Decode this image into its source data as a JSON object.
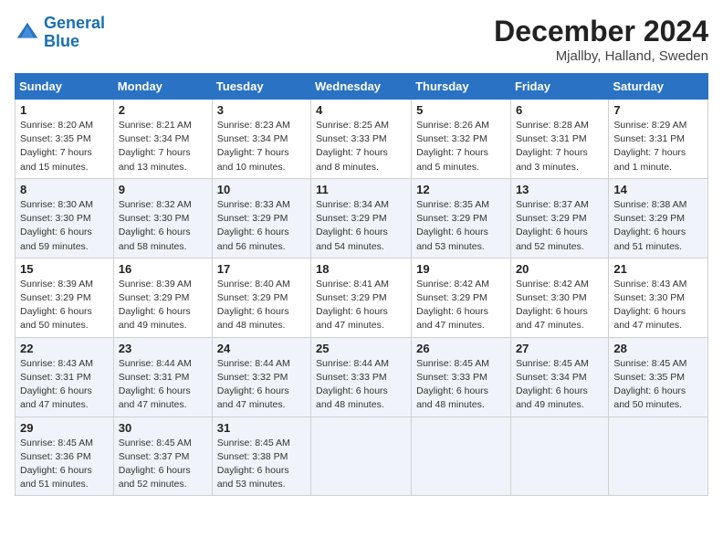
{
  "logo": {
    "line1": "General",
    "line2": "Blue"
  },
  "title": "December 2024",
  "location": "Mjallby, Halland, Sweden",
  "weekdays": [
    "Sunday",
    "Monday",
    "Tuesday",
    "Wednesday",
    "Thursday",
    "Friday",
    "Saturday"
  ],
  "weeks": [
    [
      {
        "day": "1",
        "sunrise": "8:20 AM",
        "sunset": "3:35 PM",
        "daylight": "7 hours and 15 minutes."
      },
      {
        "day": "2",
        "sunrise": "8:21 AM",
        "sunset": "3:34 PM",
        "daylight": "7 hours and 13 minutes."
      },
      {
        "day": "3",
        "sunrise": "8:23 AM",
        "sunset": "3:34 PM",
        "daylight": "7 hours and 10 minutes."
      },
      {
        "day": "4",
        "sunrise": "8:25 AM",
        "sunset": "3:33 PM",
        "daylight": "7 hours and 8 minutes."
      },
      {
        "day": "5",
        "sunrise": "8:26 AM",
        "sunset": "3:32 PM",
        "daylight": "7 hours and 5 minutes."
      },
      {
        "day": "6",
        "sunrise": "8:28 AM",
        "sunset": "3:31 PM",
        "daylight": "7 hours and 3 minutes."
      },
      {
        "day": "7",
        "sunrise": "8:29 AM",
        "sunset": "3:31 PM",
        "daylight": "7 hours and 1 minute."
      }
    ],
    [
      {
        "day": "8",
        "sunrise": "8:30 AM",
        "sunset": "3:30 PM",
        "daylight": "6 hours and 59 minutes."
      },
      {
        "day": "9",
        "sunrise": "8:32 AM",
        "sunset": "3:30 PM",
        "daylight": "6 hours and 58 minutes."
      },
      {
        "day": "10",
        "sunrise": "8:33 AM",
        "sunset": "3:29 PM",
        "daylight": "6 hours and 56 minutes."
      },
      {
        "day": "11",
        "sunrise": "8:34 AM",
        "sunset": "3:29 PM",
        "daylight": "6 hours and 54 minutes."
      },
      {
        "day": "12",
        "sunrise": "8:35 AM",
        "sunset": "3:29 PM",
        "daylight": "6 hours and 53 minutes."
      },
      {
        "day": "13",
        "sunrise": "8:37 AM",
        "sunset": "3:29 PM",
        "daylight": "6 hours and 52 minutes."
      },
      {
        "day": "14",
        "sunrise": "8:38 AM",
        "sunset": "3:29 PM",
        "daylight": "6 hours and 51 minutes."
      }
    ],
    [
      {
        "day": "15",
        "sunrise": "8:39 AM",
        "sunset": "3:29 PM",
        "daylight": "6 hours and 50 minutes."
      },
      {
        "day": "16",
        "sunrise": "8:39 AM",
        "sunset": "3:29 PM",
        "daylight": "6 hours and 49 minutes."
      },
      {
        "day": "17",
        "sunrise": "8:40 AM",
        "sunset": "3:29 PM",
        "daylight": "6 hours and 48 minutes."
      },
      {
        "day": "18",
        "sunrise": "8:41 AM",
        "sunset": "3:29 PM",
        "daylight": "6 hours and 47 minutes."
      },
      {
        "day": "19",
        "sunrise": "8:42 AM",
        "sunset": "3:29 PM",
        "daylight": "6 hours and 47 minutes."
      },
      {
        "day": "20",
        "sunrise": "8:42 AM",
        "sunset": "3:30 PM",
        "daylight": "6 hours and 47 minutes."
      },
      {
        "day": "21",
        "sunrise": "8:43 AM",
        "sunset": "3:30 PM",
        "daylight": "6 hours and 47 minutes."
      }
    ],
    [
      {
        "day": "22",
        "sunrise": "8:43 AM",
        "sunset": "3:31 PM",
        "daylight": "6 hours and 47 minutes."
      },
      {
        "day": "23",
        "sunrise": "8:44 AM",
        "sunset": "3:31 PM",
        "daylight": "6 hours and 47 minutes."
      },
      {
        "day": "24",
        "sunrise": "8:44 AM",
        "sunset": "3:32 PM",
        "daylight": "6 hours and 47 minutes."
      },
      {
        "day": "25",
        "sunrise": "8:44 AM",
        "sunset": "3:33 PM",
        "daylight": "6 hours and 48 minutes."
      },
      {
        "day": "26",
        "sunrise": "8:45 AM",
        "sunset": "3:33 PM",
        "daylight": "6 hours and 48 minutes."
      },
      {
        "day": "27",
        "sunrise": "8:45 AM",
        "sunset": "3:34 PM",
        "daylight": "6 hours and 49 minutes."
      },
      {
        "day": "28",
        "sunrise": "8:45 AM",
        "sunset": "3:35 PM",
        "daylight": "6 hours and 50 minutes."
      }
    ],
    [
      {
        "day": "29",
        "sunrise": "8:45 AM",
        "sunset": "3:36 PM",
        "daylight": "6 hours and 51 minutes."
      },
      {
        "day": "30",
        "sunrise": "8:45 AM",
        "sunset": "3:37 PM",
        "daylight": "6 hours and 52 minutes."
      },
      {
        "day": "31",
        "sunrise": "8:45 AM",
        "sunset": "3:38 PM",
        "daylight": "6 hours and 53 minutes."
      },
      null,
      null,
      null,
      null
    ]
  ],
  "labels": {
    "sunrise": "Sunrise:",
    "sunset": "Sunset:",
    "daylight": "Daylight:"
  }
}
